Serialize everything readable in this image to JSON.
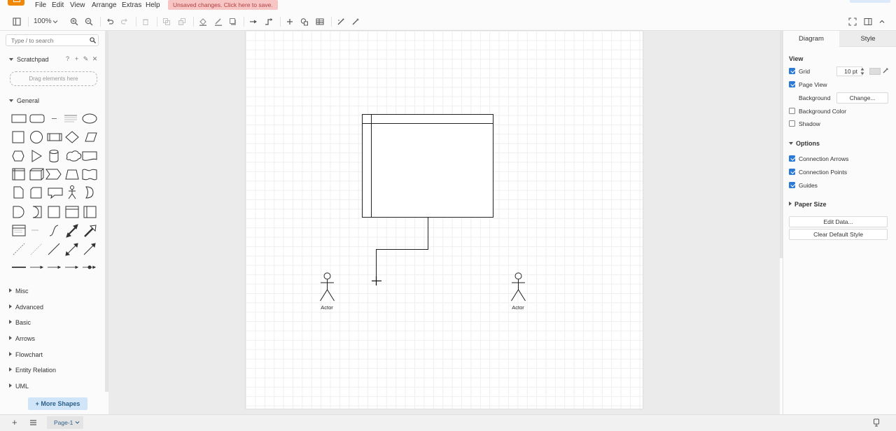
{
  "menubar": {
    "items": [
      "File",
      "Edit",
      "View",
      "Arrange",
      "Extras",
      "Help"
    ],
    "unsaved_notice": "Unsaved changes. Click here to save."
  },
  "toolbar": {
    "zoom": "100%"
  },
  "sidebar": {
    "search_placeholder": "Type / to search",
    "scratchpad_title": "Scratchpad",
    "scratchpad_drop": "Drag elements here",
    "general_title": "General",
    "sections": [
      "Misc",
      "Advanced",
      "Basic",
      "Arrows",
      "Flowchart",
      "Entity Relation",
      "UML"
    ],
    "more_shapes": "+ More Shapes"
  },
  "canvas": {
    "actor_left_label": "Actor",
    "actor_right_label": "Actor"
  },
  "format_panel": {
    "tabs": [
      "Diagram",
      "Style"
    ],
    "view_title": "View",
    "grid_label": "Grid",
    "grid_checked": true,
    "grid_size": "10 pt",
    "page_view_label": "Page View",
    "page_view_checked": true,
    "background_label": "Background",
    "change_button": "Change...",
    "background_color_label": "Background Color",
    "background_color_checked": false,
    "shadow_label": "Shadow",
    "shadow_checked": false,
    "options_title": "Options",
    "connection_arrows_label": "Connection Arrows",
    "connection_arrows_checked": true,
    "connection_points_label": "Connection Points",
    "connection_points_checked": true,
    "guides_label": "Guides",
    "guides_checked": true,
    "paper_size_title": "Paper Size",
    "edit_data_button": "Edit Data...",
    "clear_style_button": "Clear Default Style"
  },
  "footer": {
    "page_tab": "Page-1"
  },
  "colors": {
    "accent": "#2d7ad6",
    "logo": "#f08705",
    "unsaved_bg": "#f8c5c5",
    "more_shapes_bg": "#d0e6f8"
  }
}
